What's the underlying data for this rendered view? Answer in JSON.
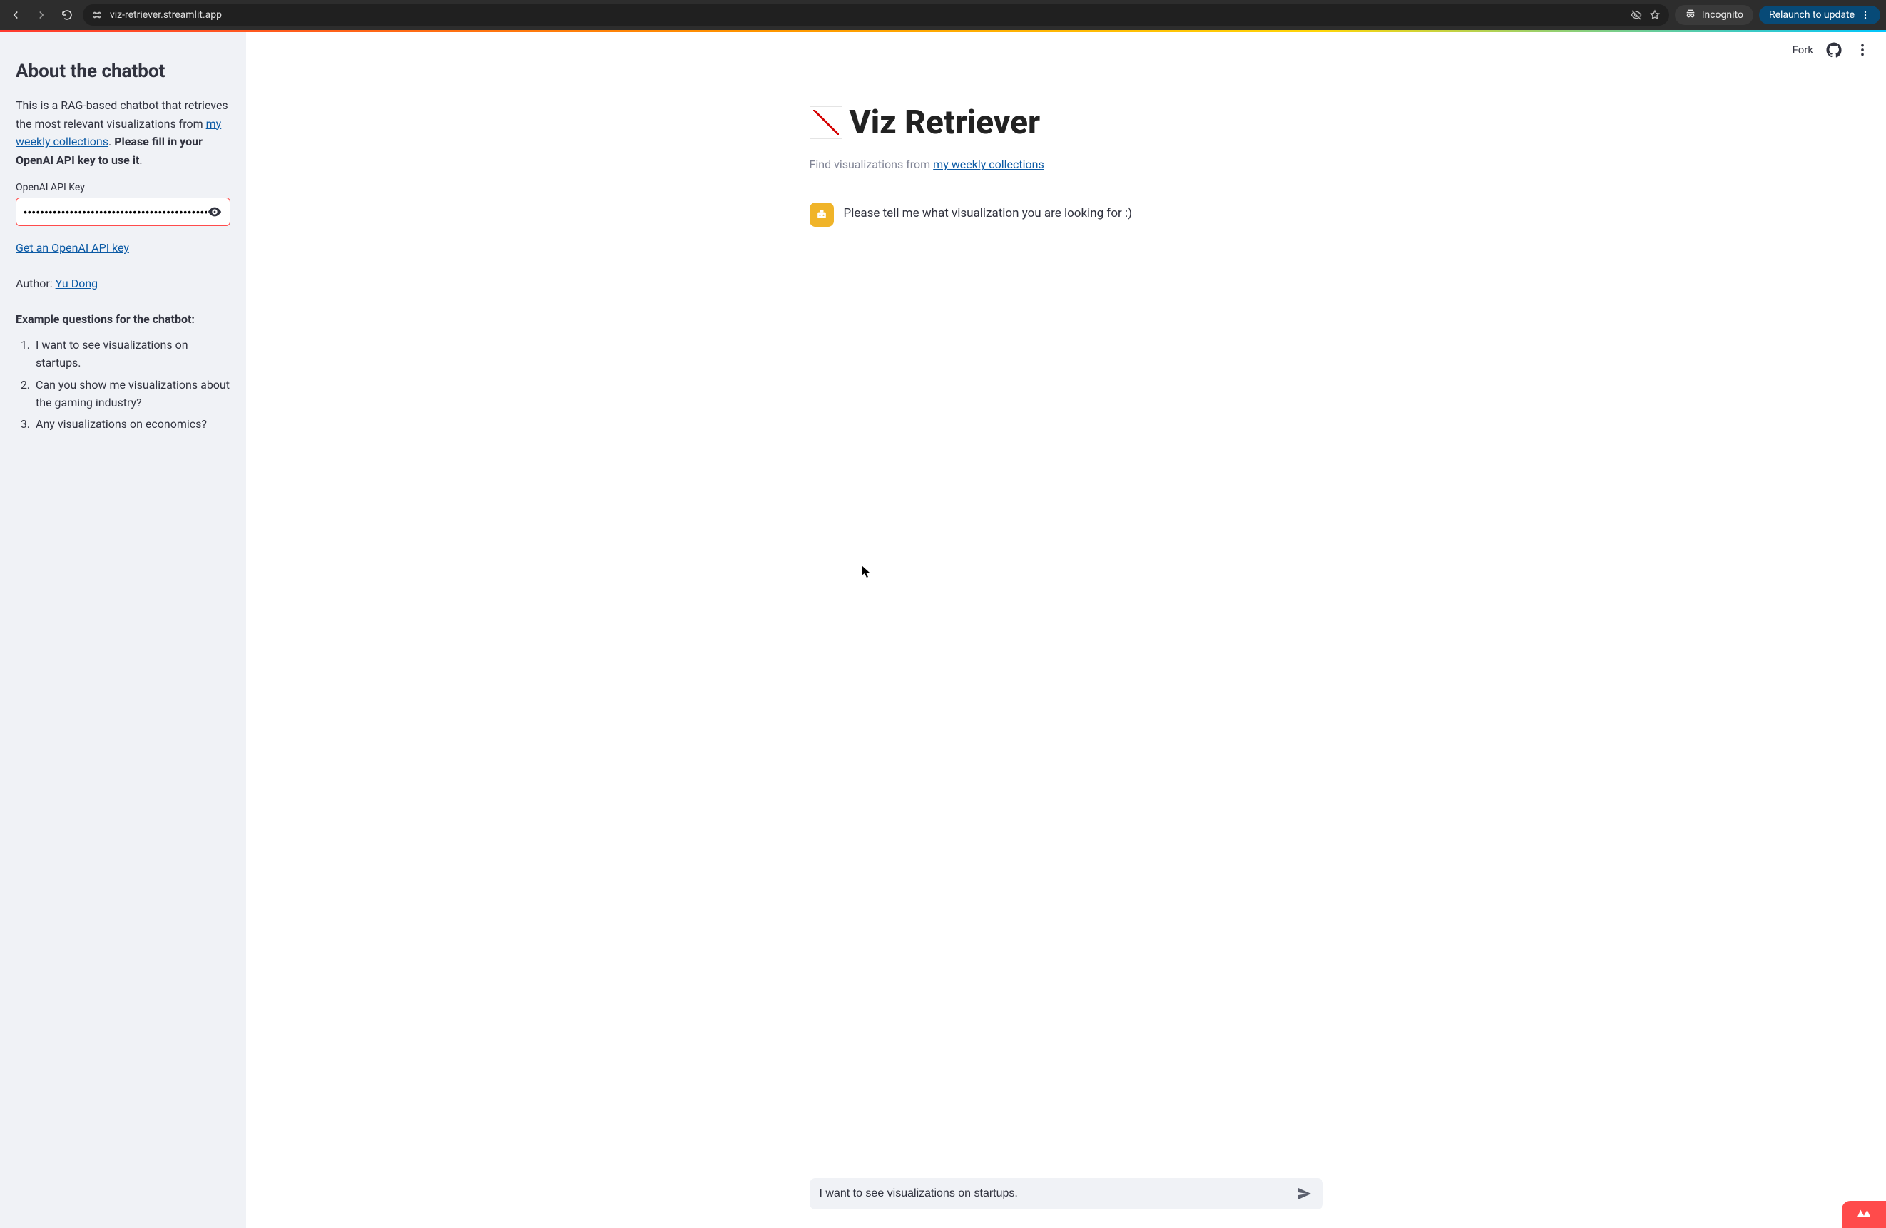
{
  "browser": {
    "url": "viz-retriever.streamlit.app",
    "incognito_label": "Incognito",
    "relaunch_label": "Relaunch to update"
  },
  "sidebar": {
    "heading": "About the chatbot",
    "intro_pre": "This is a RAG-based chatbot that retrieves the most relevant visualizations from ",
    "intro_link": "my weekly collections",
    "intro_post": ". ",
    "intro_bold": "Please fill in your OpenAI API key to use it",
    "intro_end": ".",
    "api_label": "OpenAI API Key",
    "api_value": "••••••••••••••••••••••••••••••••••••••••••••••••••",
    "get_key_link": "Get an OpenAI API key",
    "author_label": "Author: ",
    "author_name": "Yu Dong",
    "examples_head": "Example questions for the chatbot:",
    "examples": [
      "I want to see visualizations on startups.",
      "Can you show me visualizations about the gaming industry?",
      "Any visualizations on economics?"
    ]
  },
  "main": {
    "fork_label": "Fork",
    "title": "Viz Retriever",
    "subtitle_pre": "Find visualizations from ",
    "subtitle_link": "my weekly collections",
    "bot_message": "Please tell me what visualization you are looking for :)",
    "chat_input_value": "I want to see visualizations on startups."
  }
}
